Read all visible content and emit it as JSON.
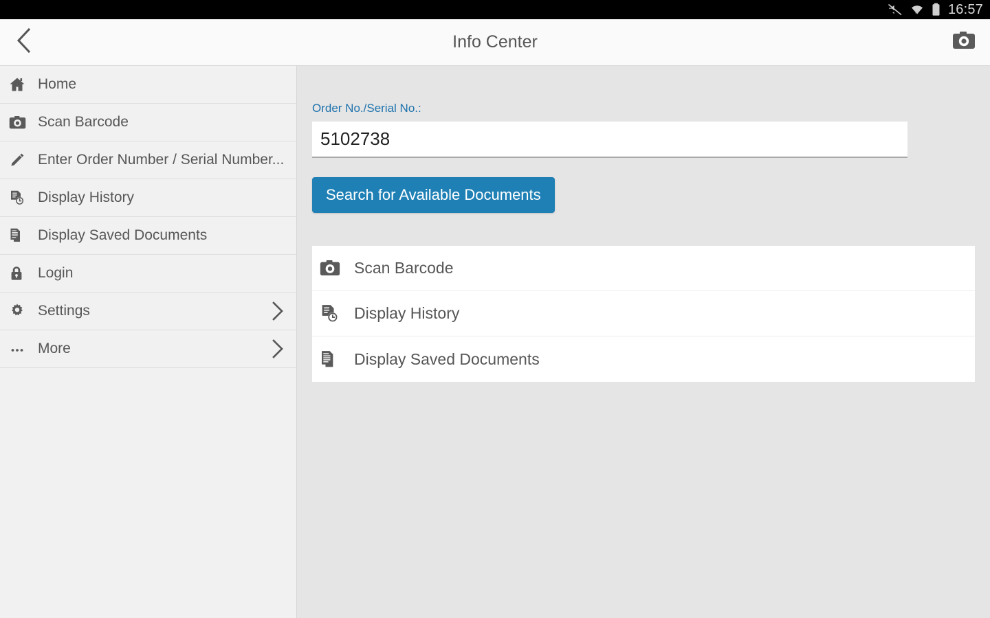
{
  "statusbar": {
    "time": "16:57",
    "icons": [
      "mute-icon",
      "wifi-icon",
      "battery-icon"
    ]
  },
  "appbar": {
    "title": "Info Center",
    "back_icon": "chevron-left-icon",
    "camera_icon": "camera-icon"
  },
  "sidebar": {
    "items": [
      {
        "label": "Home",
        "icon": "home-icon",
        "chevron": false
      },
      {
        "label": "Scan Barcode",
        "icon": "camera-icon",
        "chevron": false
      },
      {
        "label": "Enter Order Number / Serial Number...",
        "icon": "pencil-icon",
        "chevron": false
      },
      {
        "label": "Display History",
        "icon": "document-clock-icon",
        "chevron": false
      },
      {
        "label": "Display Saved Documents",
        "icon": "documents-stack-icon",
        "chevron": false
      },
      {
        "label": "Login",
        "icon": "lock-icon",
        "chevron": false
      },
      {
        "label": "Settings",
        "icon": "gear-icon",
        "chevron": true
      },
      {
        "label": "More",
        "icon": "ellipsis-icon",
        "chevron": true
      }
    ]
  },
  "main": {
    "field_label": "Order No./Serial No.:",
    "input_value": "5102738",
    "input_placeholder": "",
    "search_button": "Search for Available Documents",
    "actions": [
      {
        "label": "Scan Barcode",
        "icon": "camera-icon"
      },
      {
        "label": "Display History",
        "icon": "document-clock-icon"
      },
      {
        "label": "Display Saved Documents",
        "icon": "documents-stack-icon"
      }
    ]
  },
  "colors": {
    "accent": "#1f80b5",
    "label": "#1d72ad",
    "sidebar_bg": "#f1f1f1",
    "main_bg": "#e5e5e5",
    "text": "#565656"
  }
}
